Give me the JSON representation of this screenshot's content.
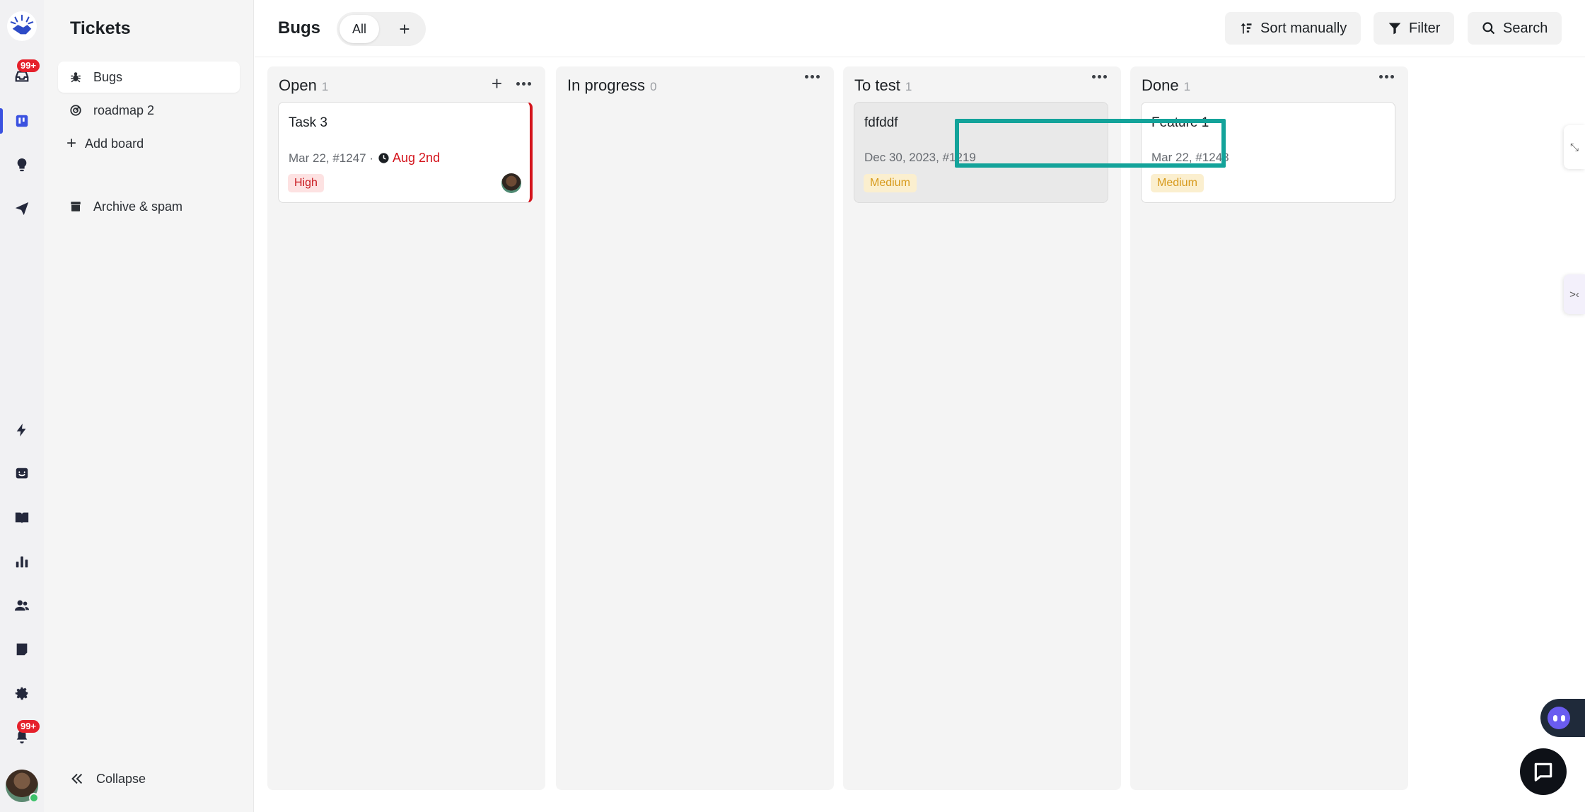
{
  "rail": {
    "inbox_badge": "99+",
    "notifications_badge": "99+",
    "icons": [
      "logo-icon",
      "inbox-icon",
      "board-icon",
      "ideas-icon",
      "send-icon",
      "lightning-icon",
      "chat-smile-icon",
      "book-icon",
      "chart-icon",
      "people-icon",
      "survey-icon",
      "gear-icon",
      "bell-icon"
    ]
  },
  "sidebar": {
    "title": "Tickets",
    "items": [
      {
        "label": "Bugs",
        "icon": "bug-icon",
        "active": true
      },
      {
        "label": "roadmap 2",
        "icon": "target-icon",
        "active": false
      }
    ],
    "add_board": "Add board",
    "archive": "Archive & spam",
    "collapse": "Collapse"
  },
  "topbar": {
    "title": "Bugs",
    "view_all": "All",
    "add_view": "+",
    "sort": "Sort manually",
    "filter": "Filter",
    "search": "Search"
  },
  "columns": [
    {
      "name": "Open",
      "count": "1",
      "cards": [
        {
          "title": "Task 3",
          "meta": "Mar 22, #1247 ·",
          "due": "Aug 2nd",
          "tag": "High"
        }
      ]
    },
    {
      "name": "In progress",
      "count": "0",
      "cards": []
    },
    {
      "name": "To test",
      "count": "1",
      "cards": [
        {
          "title": "fdfddf",
          "meta": "Dec 30, 2023, #1219",
          "tag": "Medium"
        }
      ]
    },
    {
      "name": "Done",
      "count": "1",
      "cards": [
        {
          "title": "Feature 1",
          "meta": "Mar 22, #1248",
          "tag": "Medium"
        }
      ]
    }
  ],
  "colors": {
    "accent": "#3b52e0",
    "high_tag_text": "#c8171d",
    "medium_tag_text": "#d79a1d",
    "highlight_box": "#13a39a",
    "badge": "#e5202b"
  }
}
